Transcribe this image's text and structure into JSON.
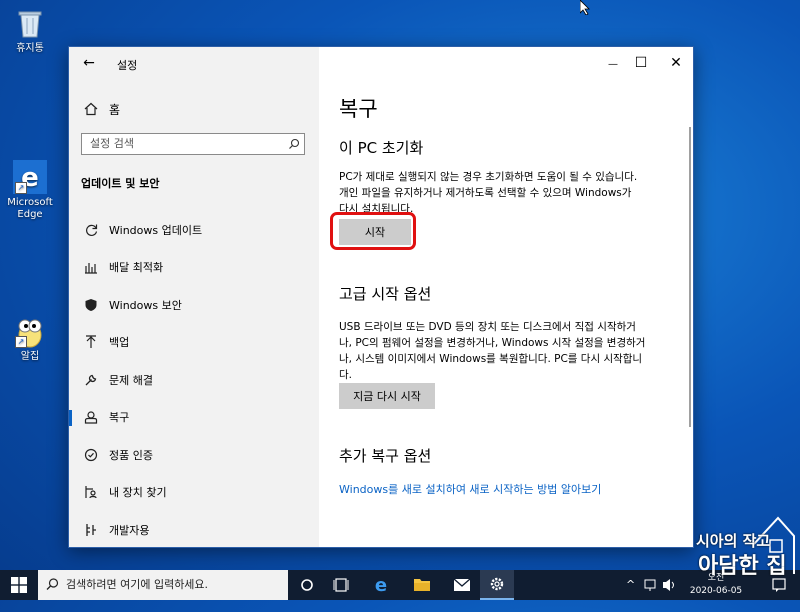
{
  "desktop": {
    "icons": [
      {
        "label": "휴지통"
      },
      {
        "label": "Microsoft Edge"
      },
      {
        "label": "알집"
      }
    ]
  },
  "window": {
    "title": "설정",
    "back_glyph": "←",
    "controls": {
      "minimize": "—",
      "maximize": "☐",
      "close": "✕"
    }
  },
  "sidebar": {
    "home_label": "홈",
    "search_placeholder": "설정 검색",
    "section_title": "업데이트 및 보안",
    "items": [
      {
        "label": "Windows 업데이트",
        "icon": "refresh-icon"
      },
      {
        "label": "배달 최적화",
        "icon": "delivery-optimization-icon"
      },
      {
        "label": "Windows 보안",
        "icon": "shield-icon"
      },
      {
        "label": "백업",
        "icon": "backup-arrow-icon"
      },
      {
        "label": "문제 해결",
        "icon": "wrench-icon"
      },
      {
        "label": "복구",
        "icon": "recovery-icon",
        "active": true
      },
      {
        "label": "정품 인증",
        "icon": "check-circle-icon"
      },
      {
        "label": "내 장치 찾기",
        "icon": "person-pin-icon"
      },
      {
        "label": "개발자용",
        "icon": "developer-icon"
      }
    ]
  },
  "main": {
    "title": "복구",
    "reset": {
      "heading": "이 PC 초기화",
      "line1": "PC가 제대로 실행되지 않는 경우 초기화하면 도움이 될 수 있습니다.",
      "line2": "개인 파일을 유지하거나 제거하도록 선택할 수 있으며 Windows가",
      "line3": "다시 설치됩니다.",
      "button": "시작"
    },
    "advanced": {
      "heading": "고급 시작 옵션",
      "line1": "USB 드라이브 또는 DVD 등의 장치 또는 디스크에서 직접 시작하거",
      "line2": "나, PC의 펌웨어 설정을 변경하거나, Windows 시작 설정을 변경하거",
      "line3": "나, 시스템 이미지에서 Windows를 복원합니다. PC를 다시 시작합니",
      "line4": "다.",
      "button": "지금 다시 시작"
    },
    "more": {
      "heading": "추가 복구 옵션",
      "link": "Windows를 새로 설치하여 새로 시작하는 방법 알아보기"
    }
  },
  "taskbar": {
    "search_placeholder": "검색하려면 여기에 입력하세요.",
    "clock_time": "오전",
    "clock_date": "2020-06-05"
  },
  "watermark": {
    "line1": "시아의 작고",
    "line2": "아담한 집"
  },
  "colors": {
    "accent": "#0b63c5",
    "highlight": "#e01010",
    "desktop": "#0a55b7",
    "taskbar": "#101d31"
  }
}
